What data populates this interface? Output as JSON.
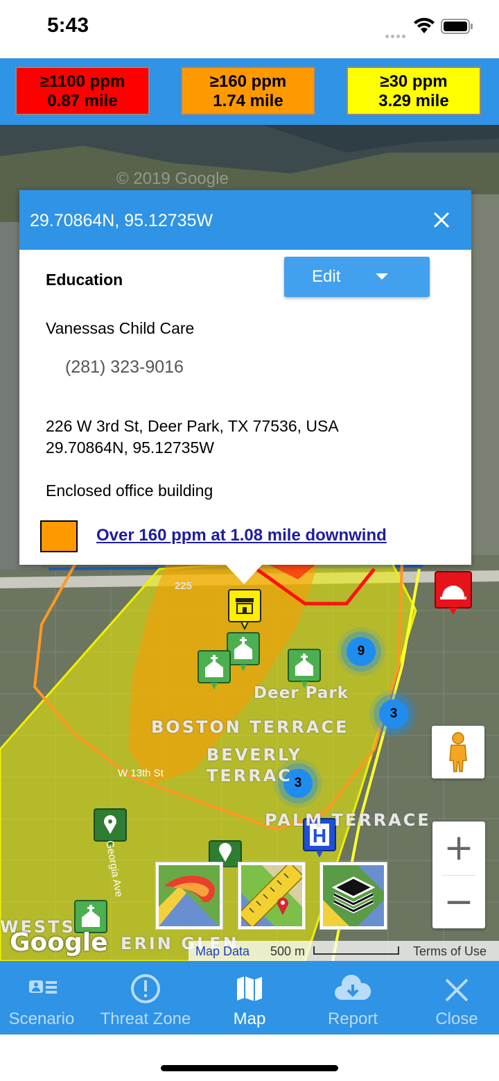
{
  "status_bar": {
    "time": "5:43"
  },
  "threat_zones": [
    {
      "ppm": "≥1100 ppm",
      "distance": "0.87 mile",
      "color": "#ff0000"
    },
    {
      "ppm": "≥160 ppm",
      "distance": "1.74 mile",
      "color": "#ff9900"
    },
    {
      "ppm": "≥30 ppm",
      "distance": "3.29 mile",
      "color": "#ffff00"
    }
  ],
  "popup": {
    "title": "29.70864N, 95.12735W",
    "category": "Education",
    "edit_label": "Edit",
    "facility_name": "Vanessas Child Care",
    "phone": "(281) 323-9016",
    "address": "226 W 3rd St, Deer Park, TX 77536, USA",
    "coordinates": "29.70864N, 95.12735W",
    "building_type": "Enclosed office building",
    "threat_link": "Over 160 ppm at 1.08 mile downwind",
    "threat_swatch_color": "#ff9900"
  },
  "map": {
    "labels": {
      "deer_park": "Deer Park",
      "boston_terrace": "BOSTON TERRACE",
      "beverly": "BEVERLY",
      "terrace": "TERRAC",
      "palm_terrace": "PALM TERRACE",
      "wests": "WESTS",
      "erin_glen": "ERIN GLEN",
      "w13th": "W 13th St",
      "georgia_ave": "Georgia Ave",
      "shield_225": "225",
      "watermark": "© 2019 Google"
    },
    "clusters": [
      "9",
      "3",
      "3"
    ],
    "google_logo": "Google",
    "map_data": "Map Data",
    "scale": "500 m",
    "terms": "Terms of Use",
    "zoom_in": "+",
    "zoom_out": "−",
    "tools": [
      "threat-plume-icon",
      "measure-map-icon",
      "layers-icon"
    ]
  },
  "tabs": [
    {
      "label": "Scenario",
      "icon": "scenario-card-icon"
    },
    {
      "label": "Threat Zone",
      "icon": "alert-circle-icon"
    },
    {
      "label": "Map",
      "icon": "map-icon",
      "active": true
    },
    {
      "label": "Report",
      "icon": "cloud-download-icon"
    },
    {
      "label": "Close",
      "icon": "close-icon"
    }
  ],
  "colors": {
    "accent": "#2f93e6",
    "inactive_tab": "#b9dcf8"
  }
}
